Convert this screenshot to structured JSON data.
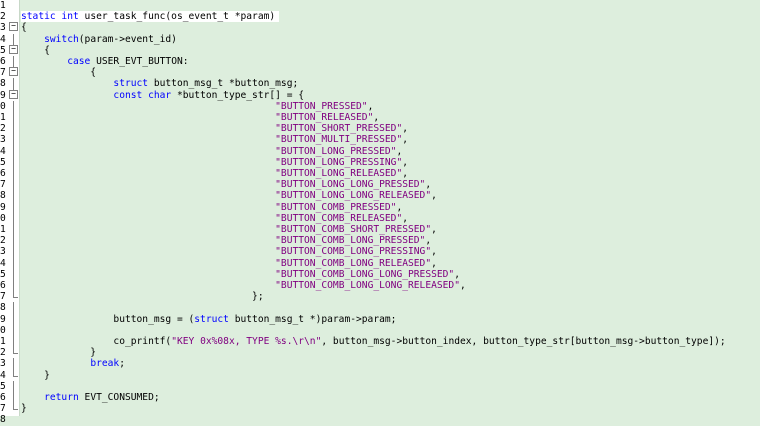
{
  "editor": {
    "current_line": 2,
    "lines": [
      {
        "num": "1",
        "fold": "",
        "tokens": []
      },
      {
        "num": "2",
        "fold": "",
        "tokens": [
          {
            "t": "static int",
            "c": "kw"
          },
          {
            "t": " user_task_func(os_event_t *param)",
            "c": "ident"
          }
        ]
      },
      {
        "num": "3",
        "fold": "minus",
        "tokens": [
          {
            "t": "{",
            "c": "ident"
          }
        ]
      },
      {
        "num": "4",
        "fold": "line",
        "tokens": [
          {
            "t": "    ",
            "c": "ident"
          },
          {
            "t": "switch",
            "c": "kw"
          },
          {
            "t": "(param->event_id)",
            "c": "ident"
          }
        ]
      },
      {
        "num": "5",
        "fold": "minus",
        "tokens": [
          {
            "t": "    {",
            "c": "ident"
          }
        ]
      },
      {
        "num": "6",
        "fold": "line",
        "tokens": [
          {
            "t": "        ",
            "c": "ident"
          },
          {
            "t": "case",
            "c": "kw"
          },
          {
            "t": " USER_EVT_BUTTON:",
            "c": "ident"
          }
        ]
      },
      {
        "num": "7",
        "fold": "minus",
        "tokens": [
          {
            "t": "            {",
            "c": "ident"
          }
        ]
      },
      {
        "num": "8",
        "fold": "line",
        "tokens": [
          {
            "t": "                ",
            "c": "ident"
          },
          {
            "t": "struct",
            "c": "kw"
          },
          {
            "t": " button_msg_t *button_msg;",
            "c": "ident"
          }
        ]
      },
      {
        "num": "9",
        "fold": "minus",
        "tokens": [
          {
            "t": "                ",
            "c": "ident"
          },
          {
            "t": "const char",
            "c": "kw"
          },
          {
            "t": " *button_type_str[] = {",
            "c": "ident"
          }
        ]
      },
      {
        "num": "0",
        "fold": "line",
        "tokens": [
          {
            "t": "                                            ",
            "c": "ident"
          },
          {
            "t": "\"BUTTON_PRESSED\"",
            "c": "str"
          },
          {
            "t": ",",
            "c": "ident"
          }
        ]
      },
      {
        "num": "1",
        "fold": "line",
        "tokens": [
          {
            "t": "                                            ",
            "c": "ident"
          },
          {
            "t": "\"BUTTON_RELEASED\"",
            "c": "str"
          },
          {
            "t": ",",
            "c": "ident"
          }
        ]
      },
      {
        "num": "2",
        "fold": "line",
        "tokens": [
          {
            "t": "                                            ",
            "c": "ident"
          },
          {
            "t": "\"BUTTON_SHORT_PRESSED\"",
            "c": "str"
          },
          {
            "t": ",",
            "c": "ident"
          }
        ]
      },
      {
        "num": "3",
        "fold": "line",
        "tokens": [
          {
            "t": "                                            ",
            "c": "ident"
          },
          {
            "t": "\"BUTTON_MULTI_PRESSED\"",
            "c": "str"
          },
          {
            "t": ",",
            "c": "ident"
          }
        ]
      },
      {
        "num": "4",
        "fold": "line",
        "tokens": [
          {
            "t": "                                            ",
            "c": "ident"
          },
          {
            "t": "\"BUTTON_LONG_PRESSED\"",
            "c": "str"
          },
          {
            "t": ",",
            "c": "ident"
          }
        ]
      },
      {
        "num": "5",
        "fold": "line",
        "tokens": [
          {
            "t": "                                            ",
            "c": "ident"
          },
          {
            "t": "\"BUTTON_LONG_PRESSING\"",
            "c": "str"
          },
          {
            "t": ",",
            "c": "ident"
          }
        ]
      },
      {
        "num": "6",
        "fold": "line",
        "tokens": [
          {
            "t": "                                            ",
            "c": "ident"
          },
          {
            "t": "\"BUTTON_LONG_RELEASED\"",
            "c": "str"
          },
          {
            "t": ",",
            "c": "ident"
          }
        ]
      },
      {
        "num": "7",
        "fold": "line",
        "tokens": [
          {
            "t": "                                            ",
            "c": "ident"
          },
          {
            "t": "\"BUTTON_LONG_LONG_PRESSED\"",
            "c": "str"
          },
          {
            "t": ",",
            "c": "ident"
          }
        ]
      },
      {
        "num": "8",
        "fold": "line",
        "tokens": [
          {
            "t": "                                            ",
            "c": "ident"
          },
          {
            "t": "\"BUTTON_LONG_LONG_RELEASED\"",
            "c": "str"
          },
          {
            "t": ",",
            "c": "ident"
          }
        ]
      },
      {
        "num": "9",
        "fold": "line",
        "tokens": [
          {
            "t": "                                            ",
            "c": "ident"
          },
          {
            "t": "\"BUTTON_COMB_PRESSED\"",
            "c": "str"
          },
          {
            "t": ",",
            "c": "ident"
          }
        ]
      },
      {
        "num": "0",
        "fold": "line",
        "tokens": [
          {
            "t": "                                            ",
            "c": "ident"
          },
          {
            "t": "\"BUTTON_COMB_RELEASED\"",
            "c": "str"
          },
          {
            "t": ",",
            "c": "ident"
          }
        ]
      },
      {
        "num": "1",
        "fold": "line",
        "tokens": [
          {
            "t": "                                            ",
            "c": "ident"
          },
          {
            "t": "\"BUTTON_COMB_SHORT_PRESSED\"",
            "c": "str"
          },
          {
            "t": ",",
            "c": "ident"
          }
        ]
      },
      {
        "num": "2",
        "fold": "line",
        "tokens": [
          {
            "t": "                                            ",
            "c": "ident"
          },
          {
            "t": "\"BUTTON_COMB_LONG_PRESSED\"",
            "c": "str"
          },
          {
            "t": ",",
            "c": "ident"
          }
        ]
      },
      {
        "num": "3",
        "fold": "line",
        "tokens": [
          {
            "t": "                                            ",
            "c": "ident"
          },
          {
            "t": "\"BUTTON_COMB_LONG_PRESSING\"",
            "c": "str"
          },
          {
            "t": ",",
            "c": "ident"
          }
        ]
      },
      {
        "num": "4",
        "fold": "line",
        "tokens": [
          {
            "t": "                                            ",
            "c": "ident"
          },
          {
            "t": "\"BUTTON_COMB_LONG_RELEASED\"",
            "c": "str"
          },
          {
            "t": ",",
            "c": "ident"
          }
        ]
      },
      {
        "num": "5",
        "fold": "line",
        "tokens": [
          {
            "t": "                                            ",
            "c": "ident"
          },
          {
            "t": "\"BUTTON_COMB_LONG_LONG_PRESSED\"",
            "c": "str"
          },
          {
            "t": ",",
            "c": "ident"
          }
        ]
      },
      {
        "num": "6",
        "fold": "line",
        "tokens": [
          {
            "t": "                                            ",
            "c": "ident"
          },
          {
            "t": "\"BUTTON_COMB_LONG_LONG_RELEASED\"",
            "c": "str"
          },
          {
            "t": ",",
            "c": "ident"
          }
        ]
      },
      {
        "num": "7",
        "fold": "corner",
        "tokens": [
          {
            "t": "                                        };",
            "c": "ident"
          }
        ]
      },
      {
        "num": "8",
        "fold": "line",
        "tokens": []
      },
      {
        "num": "9",
        "fold": "line",
        "tokens": [
          {
            "t": "                button_msg = (",
            "c": "ident"
          },
          {
            "t": "struct",
            "c": "kw"
          },
          {
            "t": " button_msg_t *)param->param;",
            "c": "ident"
          }
        ]
      },
      {
        "num": "0",
        "fold": "line",
        "tokens": []
      },
      {
        "num": "1",
        "fold": "line",
        "tokens": [
          {
            "t": "                co_printf(",
            "c": "ident"
          },
          {
            "t": "\"KEY 0x%08x, TYPE %s.\\r\\n\"",
            "c": "str"
          },
          {
            "t": ", button_msg->button_index, button_type_str[button_msg->button_type]);",
            "c": "ident"
          }
        ]
      },
      {
        "num": "2",
        "fold": "corner",
        "tokens": [
          {
            "t": "            }",
            "c": "ident"
          }
        ]
      },
      {
        "num": "3",
        "fold": "line",
        "tokens": [
          {
            "t": "            ",
            "c": "ident"
          },
          {
            "t": "break",
            "c": "kw"
          },
          {
            "t": ";",
            "c": "ident"
          }
        ]
      },
      {
        "num": "4",
        "fold": "corner",
        "tokens": [
          {
            "t": "    }",
            "c": "ident"
          }
        ]
      },
      {
        "num": "5",
        "fold": "line",
        "tokens": []
      },
      {
        "num": "6",
        "fold": "line",
        "tokens": [
          {
            "t": "    ",
            "c": "ident"
          },
          {
            "t": "return",
            "c": "kw"
          },
          {
            "t": " EVT_CONSUMED;",
            "c": "ident"
          }
        ]
      },
      {
        "num": "7",
        "fold": "corner",
        "tokens": [
          {
            "t": "}",
            "c": "ident"
          }
        ]
      },
      {
        "num": "8",
        "fold": "",
        "tokens": []
      }
    ]
  }
}
